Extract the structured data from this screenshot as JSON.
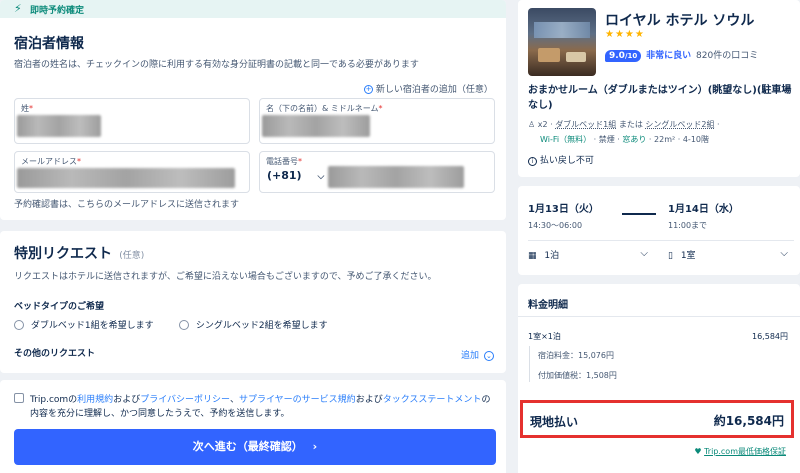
{
  "banner": {
    "label": "即時予約確定"
  },
  "guest": {
    "title": "宿泊者情報",
    "notice": "宿泊者の姓名は、チェックインの際に利用する有効な身分証明書の記載と同一である必要があります",
    "add_guest": "新しい宿泊者の追加（任意）",
    "last_name_label": "姓",
    "first_name_label": "名（下の名前）& ミドルネーム",
    "email_label": "メールアドレス",
    "phone_label": "電話番号",
    "phone_code": "(+81)",
    "email_note": "予約確認書は、こちらのメールアドレスに送信されます"
  },
  "special": {
    "title": "特別リクエスト",
    "optional": "(任意)",
    "desc": "リクエストはホテルに送信されますが、ご希望に沿えない場合もございますので、予めご了承ください。",
    "bed_title": "ベッドタイプのご希望",
    "bed_options": [
      "ダブルベッド1組を希望します",
      "シングルベッド2組を希望します"
    ],
    "other_title": "その他のリクエスト",
    "add": "追加"
  },
  "agree": {
    "t1": "Trip.comの",
    "l1": "利用規約",
    "t2": "および",
    "l2": "プライバシーポリシー",
    "t3": "、",
    "l3": "サプライヤーのサービス規約",
    "t4": "および",
    "l4": "タックスステートメント",
    "t5": "の",
    "line2": "内容を充分に理解し、かつ同意したうえで、予約を送信します。"
  },
  "next_button": "次へ進む（最終確認）",
  "hotel": {
    "name": "ロイヤル ホテル ソウル",
    "stars": "★★★★",
    "score": "9.0",
    "score_max": "/10",
    "score_text": "非常に良い",
    "reviews": "820件の口コミ",
    "room": "おまかせルーム（ダブルまたはツイン）(眺望なし)(駐車場なし)",
    "guests": "x2",
    "bed_a": "ダブルベッド1組",
    "bed_or": "または",
    "bed_b": "シングルベッド2組",
    "wifi": "Wi-Fi（無料）",
    "nosmoke": "禁煙",
    "window": "窓あり",
    "size": "22m²",
    "floor": "4-10階",
    "refund": "払い戻し不可"
  },
  "stay": {
    "checkin_date": "1月13日（火）",
    "checkin_time": "14:30～06:00",
    "checkout_date": "1月14日（水）",
    "checkout_time": "11:00まで",
    "nights": "1泊",
    "rooms": "1室"
  },
  "price": {
    "title": "料金明細",
    "line_label": "1室×1泊",
    "line_value": "16,584円",
    "fee": "宿泊料金：15,076円",
    "tax": "付加価値税：1,508円",
    "pay_label": "現地払い",
    "pay_value": "約16,584円",
    "guarantee": "Trip.com最低価格保証"
  }
}
